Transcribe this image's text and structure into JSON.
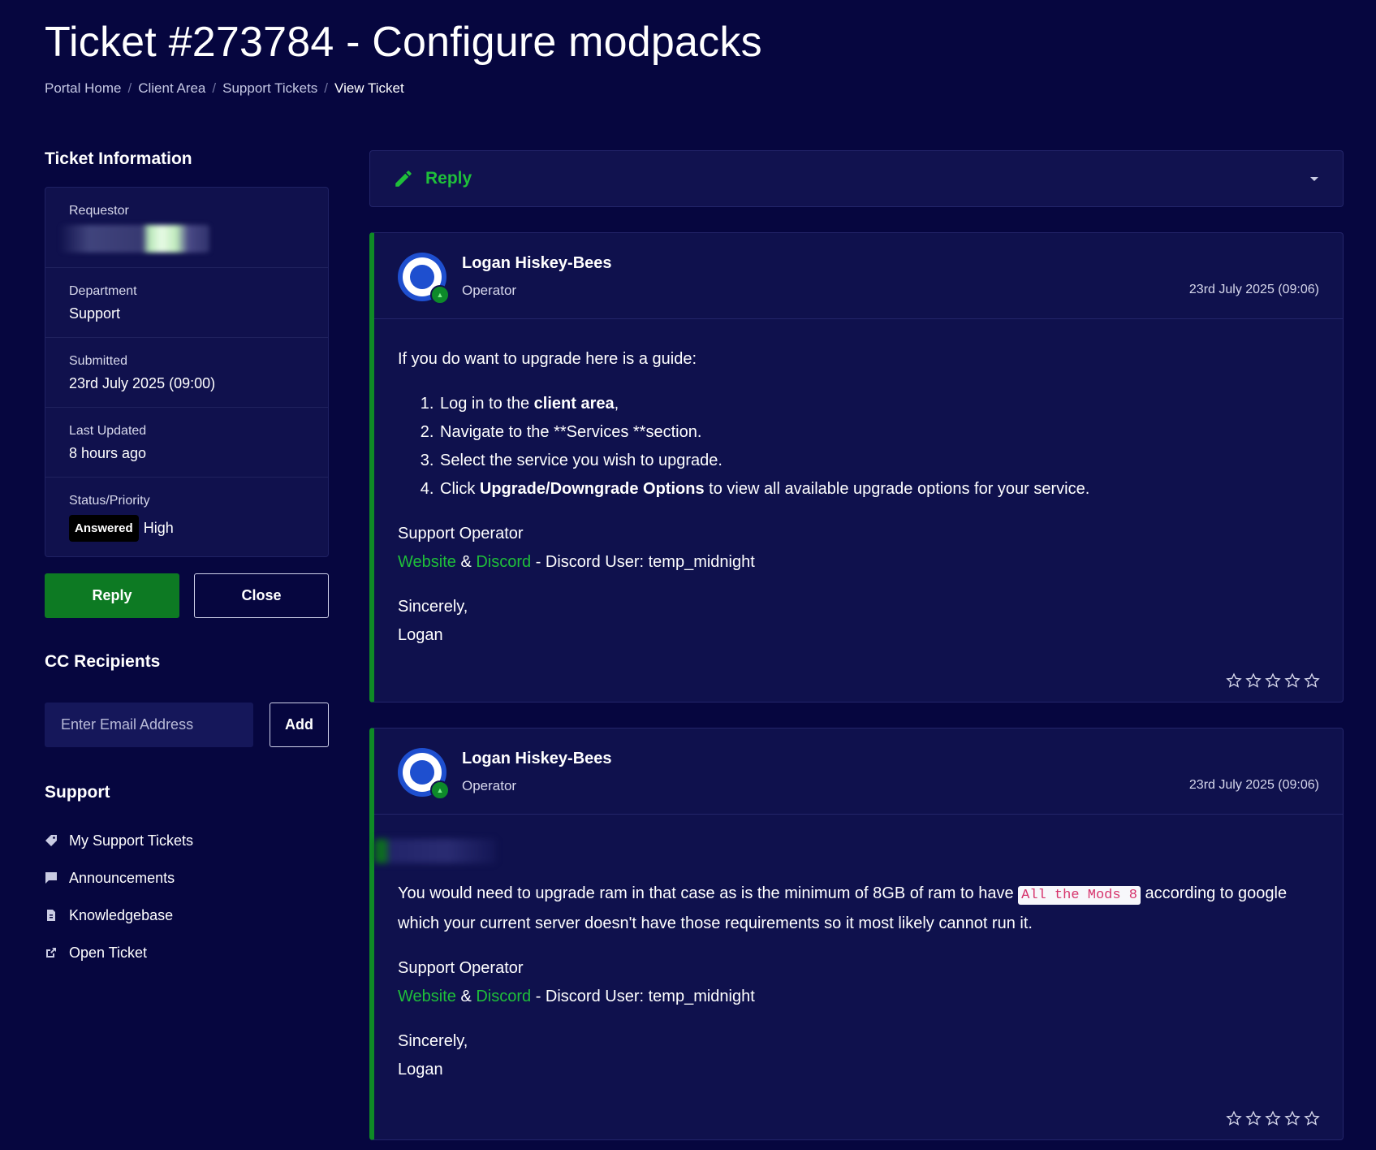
{
  "page": {
    "title": "Ticket #273784 - Configure modpacks",
    "breadcrumb": [
      "Portal Home",
      "Client Area",
      "Support Tickets",
      "View Ticket"
    ]
  },
  "sidebar": {
    "ticket_info_heading": "Ticket Information",
    "rows": {
      "requestor_label": "Requestor",
      "department_label": "Department",
      "department_value": "Support",
      "submitted_label": "Submitted",
      "submitted_value": "23rd July 2025 (09:00)",
      "last_updated_label": "Last Updated",
      "last_updated_value": "8 hours ago",
      "status_label": "Status/Priority",
      "status_value": "Answered",
      "priority_value": "High"
    },
    "reply_button": "Reply",
    "close_button": "Close",
    "cc_heading": "CC Recipients",
    "cc_placeholder": "Enter Email Address",
    "add_button": "Add",
    "support_heading": "Support",
    "support_links": [
      "My Support Tickets",
      "Announcements",
      "Knowledgebase",
      "Open Ticket"
    ]
  },
  "reply_bar": {
    "label": "Reply"
  },
  "messages": [
    {
      "author": "Logan Hiskey-Bees",
      "role": "Operator",
      "date": "23rd July 2025 (09:06)",
      "intro": "If you do want to upgrade here is a guide:",
      "steps": {
        "s1_pre": "Log in to the ",
        "s1_bold": "client area",
        "s1_post": ",",
        "s2": "Navigate to the **Services **section.",
        "s3": "Select the service you wish to upgrade.",
        "s4_pre": "Click ",
        "s4_bold": "Upgrade/Downgrade Options",
        "s4_post": " to view all available upgrade options for your service."
      },
      "sig_title": "Support Operator",
      "sig_website": "Website",
      "sig_amp": " & ",
      "sig_discord": "Discord",
      "sig_discord_user": " - Discord User: temp_midnight",
      "closing": "Sincerely,",
      "name": "Logan"
    },
    {
      "author": "Logan Hiskey-Bees",
      "role": "Operator",
      "date": "23rd July 2025 (09:06)",
      "body_pre": "You would need to upgrade ram in that case as is the minimum of 8GB of ram to have ",
      "body_code": "All the Mods 8",
      "body_post": " according to google which your current server doesn't have those requirements so it most likely cannot run it.",
      "sig_title": "Support Operator",
      "sig_website": "Website",
      "sig_amp": " & ",
      "sig_discord": "Discord",
      "sig_discord_user": " - Discord User: temp_midnight",
      "closing": "Sincerely,",
      "name": "Logan"
    }
  ],
  "colors": {
    "background": "#06063f",
    "accent_green": "#1fbf3a",
    "button_green": "#0d7a23"
  }
}
